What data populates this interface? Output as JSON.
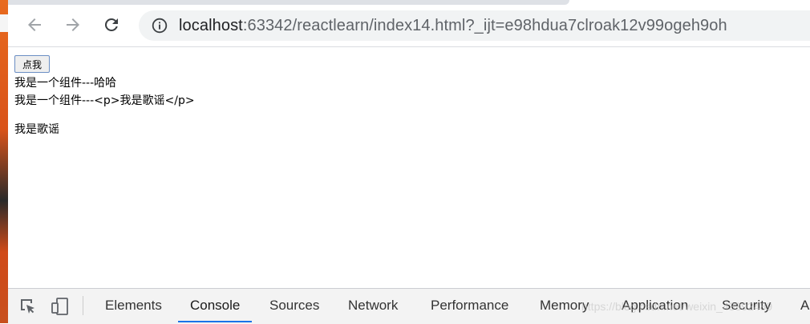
{
  "browser": {
    "url_host": "localhost",
    "url_rest": ":63342/reactlearn/index14.html?_ijt=e98hdua7clroak12v99ogeh9oh",
    "icons": [
      "back-arrow-icon",
      "forward-arrow-icon",
      "reload-icon",
      "info-icon"
    ]
  },
  "page": {
    "button_label": "点我",
    "line1": "我是一个组件---哈哈",
    "line2": "我是一个组件---<p>我是歌谣</p>",
    "line3": "我是歌谣"
  },
  "devtools": {
    "tabs": [
      "Elements",
      "Console",
      "Sources",
      "Network",
      "Performance",
      "Memory",
      "Application",
      "Security",
      "A"
    ],
    "active_tab": "Console",
    "accent": "#1a73e8"
  },
  "watermark": "https://blog.csdn.net/weixin_43392489"
}
